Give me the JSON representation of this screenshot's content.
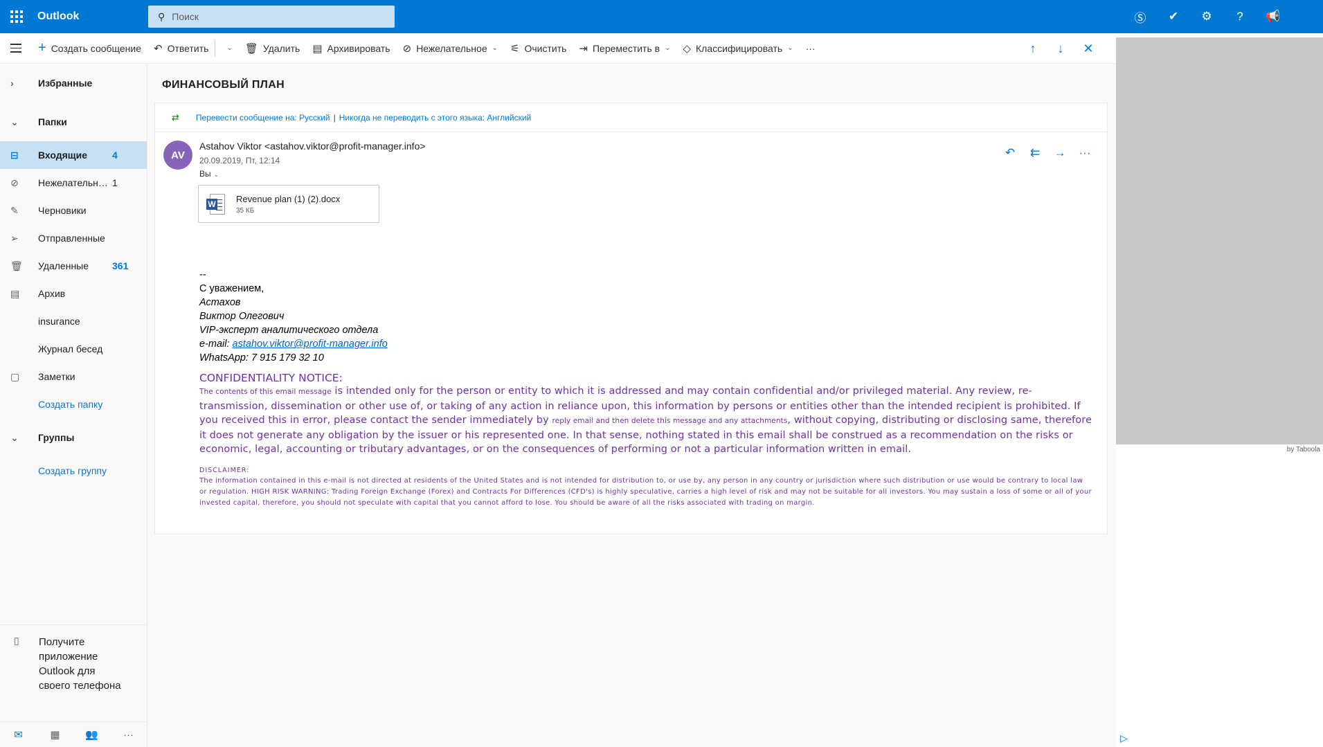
{
  "app": {
    "title": "Outlook"
  },
  "search": {
    "placeholder": "Поиск"
  },
  "toolbar": {
    "new_message": "Создать сообщение",
    "reply": "Ответить",
    "delete": "Удалить",
    "archive": "Архивировать",
    "junk": "Нежелательное",
    "sweep": "Очистить",
    "move_to": "Переместить в",
    "categorize": "Классифицировать",
    "more": "···"
  },
  "sidebar": {
    "favorites": "Избранные",
    "folders_header": "Папки",
    "folders": [
      {
        "label": "Входящие",
        "count": "4",
        "icon": "inbox-icon",
        "selected": true
      },
      {
        "label": "Нежелательная ...",
        "count": "1",
        "icon": "junk-icon"
      },
      {
        "label": "Черновики",
        "count": "",
        "icon": "pencil-icon"
      },
      {
        "label": "Отправленные",
        "count": "",
        "icon": "send-icon"
      },
      {
        "label": "Удаленные",
        "count": "361",
        "icon": "trash-icon"
      },
      {
        "label": "Архив",
        "count": "",
        "icon": "archive-icon"
      },
      {
        "label": "insurance",
        "count": "",
        "icon": ""
      },
      {
        "label": "Журнал бесед",
        "count": "",
        "icon": ""
      },
      {
        "label": "Заметки",
        "count": "",
        "icon": "notes-icon"
      }
    ],
    "create_folder": "Создать папку",
    "groups_header": "Группы",
    "create_group": "Создать группу",
    "promo": "Получите приложение Outlook для своего телефона"
  },
  "message": {
    "subject": "ФИНАНСОВЫЙ ПЛАН",
    "translate_link": "Перевести сообщение на: Русский",
    "translate_separator": "|",
    "never_translate_link": "Никогда не переводить с этого языка: Английский",
    "avatar_initials": "AV",
    "from": "Astahov Viktor <astahov.viktor@profit-manager.info>",
    "date": "20.09.2019, Пт, 12:14",
    "to": "Вы",
    "attachment": {
      "name": "Revenue plan (1) (2).docx",
      "size": "35 КБ"
    },
    "signature": {
      "dashes": "--",
      "greeting": "С уважением,",
      "surname": "Астахов",
      "name": "Виктор Олегович",
      "position": "VIP-эксперт аналитического отдела",
      "email_label": "e-mail: ",
      "email": "astahov.viktor@profit-manager.info",
      "whatsapp": "WhatsApp: 7 915 179 32 10"
    },
    "confidentiality_title": "CONFIDENTIALITY NOTICE:",
    "confidentiality_small_1": "The contents of this email message",
    "confidentiality_part_1": " is intended only for the person or entity to which it is addressed and may contain confidential and/or privileged material. Any review, re-transmission, dissemination or other use of, or taking of any action in reliance upon, this information by persons or entities other than the intended recipient is prohibited. If you received this in error, please contact the sender immediately by ",
    "confidentiality_small_2": "reply email and then delete this message and any attachments",
    "confidentiality_part_2": ", without copying, distributing or disclosing same, therefore it does not generate any obligation by the issuer or his represented one. In that sense, nothing stated in this email shall be construed as a recommendation on the risks or economic, legal, accounting or tributary advantages, or on the consequences of performing or not a particular information written in email.",
    "disclaimer_title": "DISCLAIMER:",
    "disclaimer_body": "The information contained in this e-mail is not directed at residents of the United States and is not intended for distribution to, or use by, any person in any country or jurisdiction where such distribution or use would be contrary to local law or regulation. HIGH RISK WARNING: Trading Foreign Exchange (Forex) and Contracts For Differences (CFD's) is highly speculative, carries a high level of risk and may not be suitable for all investors. You may sustain a loss of some or all of your invested capital, therefore, you should not speculate with capital that you cannot afford to lose. You should be aware of all the risks associated with trading on margin."
  },
  "ad": {
    "label": "by Taboola"
  },
  "colors": {
    "brand": "#0078d4",
    "avatar": "#8764b8",
    "notice": "#7030a0"
  }
}
